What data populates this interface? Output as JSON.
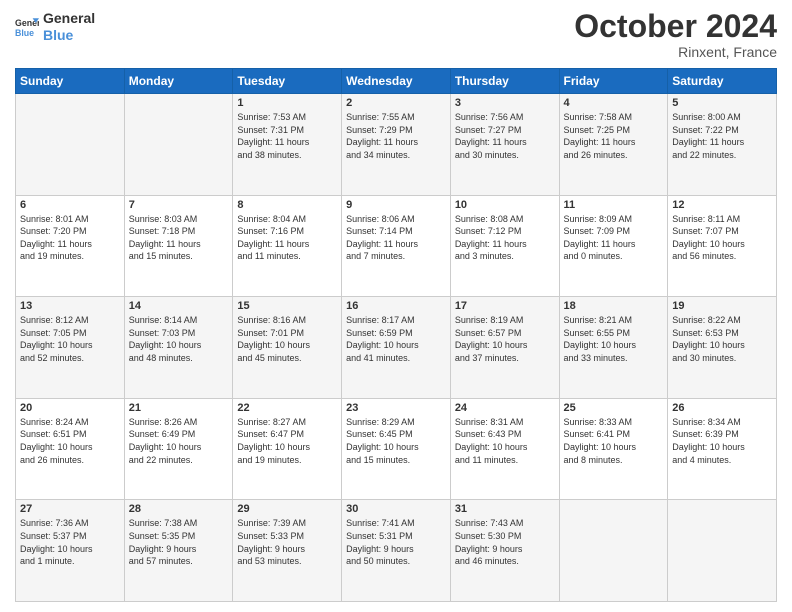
{
  "header": {
    "logo_line1": "General",
    "logo_line2": "Blue",
    "month": "October 2024",
    "location": "Rinxent, France"
  },
  "days_of_week": [
    "Sunday",
    "Monday",
    "Tuesday",
    "Wednesday",
    "Thursday",
    "Friday",
    "Saturday"
  ],
  "weeks": [
    [
      {
        "day": "",
        "info": ""
      },
      {
        "day": "",
        "info": ""
      },
      {
        "day": "1",
        "info": "Sunrise: 7:53 AM\nSunset: 7:31 PM\nDaylight: 11 hours\nand 38 minutes."
      },
      {
        "day": "2",
        "info": "Sunrise: 7:55 AM\nSunset: 7:29 PM\nDaylight: 11 hours\nand 34 minutes."
      },
      {
        "day": "3",
        "info": "Sunrise: 7:56 AM\nSunset: 7:27 PM\nDaylight: 11 hours\nand 30 minutes."
      },
      {
        "day": "4",
        "info": "Sunrise: 7:58 AM\nSunset: 7:25 PM\nDaylight: 11 hours\nand 26 minutes."
      },
      {
        "day": "5",
        "info": "Sunrise: 8:00 AM\nSunset: 7:22 PM\nDaylight: 11 hours\nand 22 minutes."
      }
    ],
    [
      {
        "day": "6",
        "info": "Sunrise: 8:01 AM\nSunset: 7:20 PM\nDaylight: 11 hours\nand 19 minutes."
      },
      {
        "day": "7",
        "info": "Sunrise: 8:03 AM\nSunset: 7:18 PM\nDaylight: 11 hours\nand 15 minutes."
      },
      {
        "day": "8",
        "info": "Sunrise: 8:04 AM\nSunset: 7:16 PM\nDaylight: 11 hours\nand 11 minutes."
      },
      {
        "day": "9",
        "info": "Sunrise: 8:06 AM\nSunset: 7:14 PM\nDaylight: 11 hours\nand 7 minutes."
      },
      {
        "day": "10",
        "info": "Sunrise: 8:08 AM\nSunset: 7:12 PM\nDaylight: 11 hours\nand 3 minutes."
      },
      {
        "day": "11",
        "info": "Sunrise: 8:09 AM\nSunset: 7:09 PM\nDaylight: 11 hours\nand 0 minutes."
      },
      {
        "day": "12",
        "info": "Sunrise: 8:11 AM\nSunset: 7:07 PM\nDaylight: 10 hours\nand 56 minutes."
      }
    ],
    [
      {
        "day": "13",
        "info": "Sunrise: 8:12 AM\nSunset: 7:05 PM\nDaylight: 10 hours\nand 52 minutes."
      },
      {
        "day": "14",
        "info": "Sunrise: 8:14 AM\nSunset: 7:03 PM\nDaylight: 10 hours\nand 48 minutes."
      },
      {
        "day": "15",
        "info": "Sunrise: 8:16 AM\nSunset: 7:01 PM\nDaylight: 10 hours\nand 45 minutes."
      },
      {
        "day": "16",
        "info": "Sunrise: 8:17 AM\nSunset: 6:59 PM\nDaylight: 10 hours\nand 41 minutes."
      },
      {
        "day": "17",
        "info": "Sunrise: 8:19 AM\nSunset: 6:57 PM\nDaylight: 10 hours\nand 37 minutes."
      },
      {
        "day": "18",
        "info": "Sunrise: 8:21 AM\nSunset: 6:55 PM\nDaylight: 10 hours\nand 33 minutes."
      },
      {
        "day": "19",
        "info": "Sunrise: 8:22 AM\nSunset: 6:53 PM\nDaylight: 10 hours\nand 30 minutes."
      }
    ],
    [
      {
        "day": "20",
        "info": "Sunrise: 8:24 AM\nSunset: 6:51 PM\nDaylight: 10 hours\nand 26 minutes."
      },
      {
        "day": "21",
        "info": "Sunrise: 8:26 AM\nSunset: 6:49 PM\nDaylight: 10 hours\nand 22 minutes."
      },
      {
        "day": "22",
        "info": "Sunrise: 8:27 AM\nSunset: 6:47 PM\nDaylight: 10 hours\nand 19 minutes."
      },
      {
        "day": "23",
        "info": "Sunrise: 8:29 AM\nSunset: 6:45 PM\nDaylight: 10 hours\nand 15 minutes."
      },
      {
        "day": "24",
        "info": "Sunrise: 8:31 AM\nSunset: 6:43 PM\nDaylight: 10 hours\nand 11 minutes."
      },
      {
        "day": "25",
        "info": "Sunrise: 8:33 AM\nSunset: 6:41 PM\nDaylight: 10 hours\nand 8 minutes."
      },
      {
        "day": "26",
        "info": "Sunrise: 8:34 AM\nSunset: 6:39 PM\nDaylight: 10 hours\nand 4 minutes."
      }
    ],
    [
      {
        "day": "27",
        "info": "Sunrise: 7:36 AM\nSunset: 5:37 PM\nDaylight: 10 hours\nand 1 minute."
      },
      {
        "day": "28",
        "info": "Sunrise: 7:38 AM\nSunset: 5:35 PM\nDaylight: 9 hours\nand 57 minutes."
      },
      {
        "day": "29",
        "info": "Sunrise: 7:39 AM\nSunset: 5:33 PM\nDaylight: 9 hours\nand 53 minutes."
      },
      {
        "day": "30",
        "info": "Sunrise: 7:41 AM\nSunset: 5:31 PM\nDaylight: 9 hours\nand 50 minutes."
      },
      {
        "day": "31",
        "info": "Sunrise: 7:43 AM\nSunset: 5:30 PM\nDaylight: 9 hours\nand 46 minutes."
      },
      {
        "day": "",
        "info": ""
      },
      {
        "day": "",
        "info": ""
      }
    ]
  ]
}
